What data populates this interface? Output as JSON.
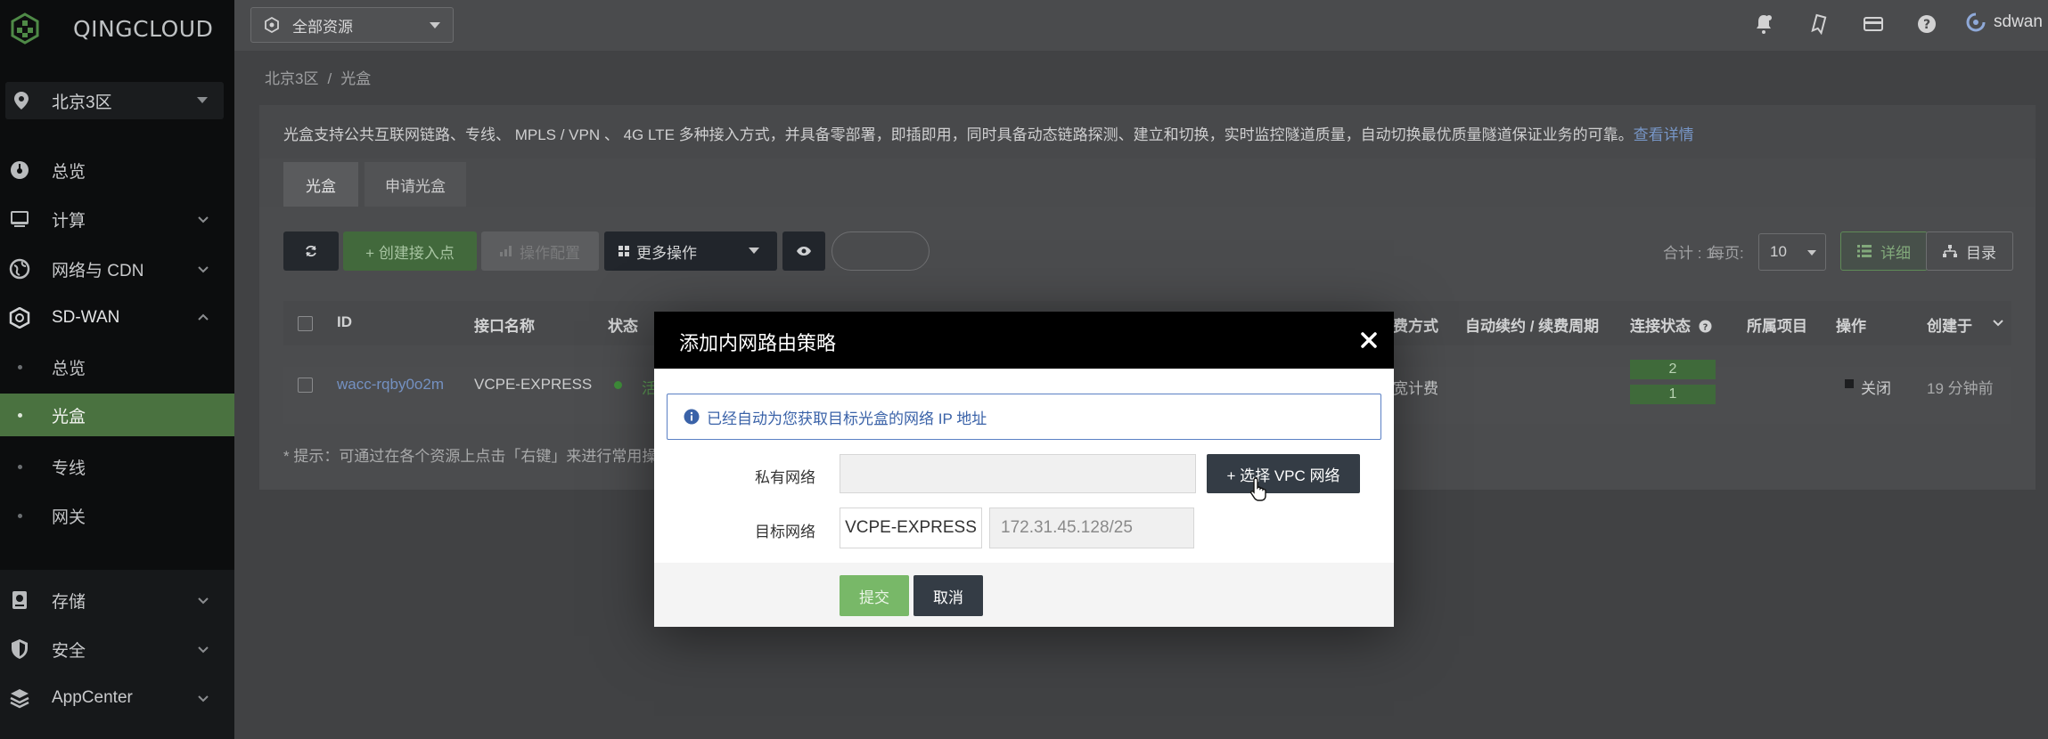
{
  "app": {
    "brand": "QINGCLOUD",
    "region": "北京3区",
    "resource_scope": "全部资源",
    "username": "sdwan",
    "accent_color": "#4a7240"
  },
  "sidebar": {
    "items": [
      {
        "label": "总览",
        "icon": "dashboard-icon"
      },
      {
        "label": "计算",
        "icon": "monitor-icon"
      },
      {
        "label": "网络与 CDN",
        "icon": "globe-icon"
      },
      {
        "label": "SD-WAN",
        "icon": "hexagon-icon"
      }
    ],
    "sdwan_children": [
      {
        "label": "总览"
      },
      {
        "label": "光盒",
        "active": true
      },
      {
        "label": "专线"
      },
      {
        "label": "网关"
      }
    ],
    "bottom_items": [
      {
        "label": "存储",
        "icon": "storage-icon"
      },
      {
        "label": "安全",
        "icon": "shield-icon"
      },
      {
        "label": "AppCenter",
        "icon": "layers-icon"
      }
    ]
  },
  "breadcrumb": {
    "region": "北京3区",
    "separator": "/",
    "page": "光盒"
  },
  "info": {
    "text": "光盒支持公共互联网链路、专线、 MPLS / VPN 、 4G LTE 多种接入方式，并具备零部署，即插即用，同时具备动态链路探测、建立和切换，实时监控隧道质量，自动切换最优质量隧道保证业务的可靠。",
    "link": "查看详情"
  },
  "tabs": [
    {
      "label": "光盒"
    },
    {
      "label": "申请光盒"
    }
  ],
  "toolbar": {
    "create_label": "+ 创建接入点",
    "batch_label": "操作配置",
    "more_label": "更多操作",
    "total_label": "合计 : 1",
    "per_page_label": "每页:",
    "per_page_value": "10",
    "view_detail_label": "详细",
    "view_dir_label": "目录"
  },
  "table": {
    "headers": {
      "id": "ID",
      "name": "接口名称",
      "status": "状态",
      "billing": "费方式",
      "renew": "自动续约 / 续费周期",
      "conn": "连接状态",
      "project": "所属项目",
      "ops": "操作",
      "created": "创建于"
    },
    "rows": [
      {
        "id": "wacc-rqby0o2m",
        "name": "VCPE-EXPRESS",
        "status": "活",
        "billing": "宽计费",
        "conn_up": "2",
        "conn_down": "1",
        "op": "关闭",
        "created": "19 分钟前"
      }
    ]
  },
  "hint": "* 提示：可通过在各个资源上点击「右键」来进行常用操作",
  "modal": {
    "title": "添加内网路由策略",
    "alert": "已经自动为您获取目标光盒的网络 IP 地址",
    "private_network_label": "私有网络",
    "private_network_value": "",
    "select_vpc_label": "+ 选择 VPC 网络",
    "target_network_label": "目标网络",
    "target_name": "VCPE-EXPRESS",
    "target_cidr": "172.31.45.128/25",
    "submit_label": "提交",
    "cancel_label": "取消"
  }
}
